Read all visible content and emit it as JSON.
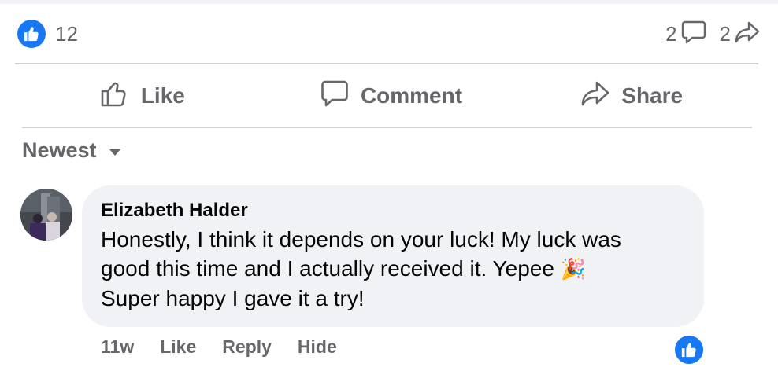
{
  "post": {
    "reaction_count": "12",
    "comment_count": "2",
    "share_count": "2",
    "accent_color": "#1877f2"
  },
  "actions": {
    "like_label": "Like",
    "comment_label": "Comment",
    "share_label": "Share"
  },
  "sort": {
    "label": "Newest"
  },
  "comment": {
    "author": "Elizabeth Halder",
    "text_line1": "Honestly, I think it depends on your luck! My luck was",
    "text_line2": "good this time and I actually received it. Yepee",
    "emoji": "🎉",
    "text_line3": "Super happy I gave it a try!",
    "time": "11w",
    "like_label": "Like",
    "reply_label": "Reply",
    "hide_label": "Hide"
  }
}
